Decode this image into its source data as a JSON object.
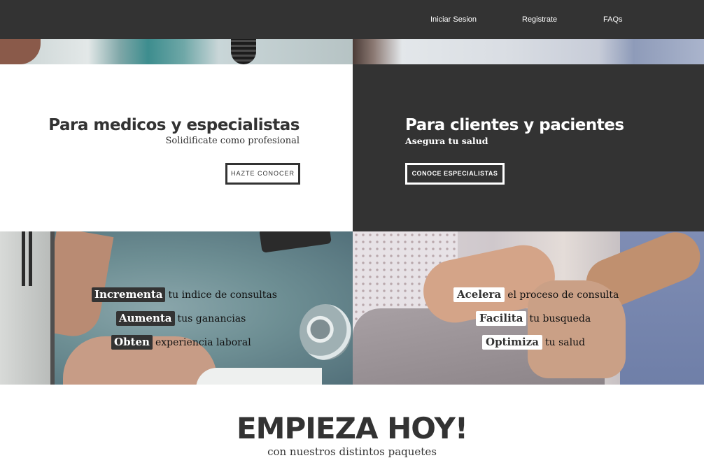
{
  "nav": {
    "login_label": "Iniciar Sesion",
    "register_label": "Registrate",
    "faqs_label": "FAQs",
    "background": "#333333"
  },
  "doctors": {
    "title": "Para medicos y especialistas",
    "subtitle": "Solidificate como profesional",
    "button_label": "HAZTE CONOCER",
    "features": [
      {
        "highlight": "Incrementa",
        "text": "tu indice de consultas"
      },
      {
        "highlight": "Aumenta",
        "text": "tus ganancias"
      },
      {
        "highlight": "Obten",
        "text": "experiencia laboral"
      }
    ]
  },
  "patients": {
    "title": "Para clientes y pacientes",
    "subtitle": "Asegura tu salud",
    "button_label": "CONOCE ESPECIALISTAS",
    "features": [
      {
        "highlight": "Acelera",
        "text": "el proceso de consulta"
      },
      {
        "highlight": "Facilita",
        "text": "tu busqueda"
      },
      {
        "highlight": "Optimiza",
        "text": "tu salud"
      }
    ]
  },
  "cta": {
    "title": "EMPIEZA HOY!",
    "subtitle": "con nuestros distintos paquetes"
  },
  "colors": {
    "dark": "#333333",
    "light": "#ffffff"
  }
}
